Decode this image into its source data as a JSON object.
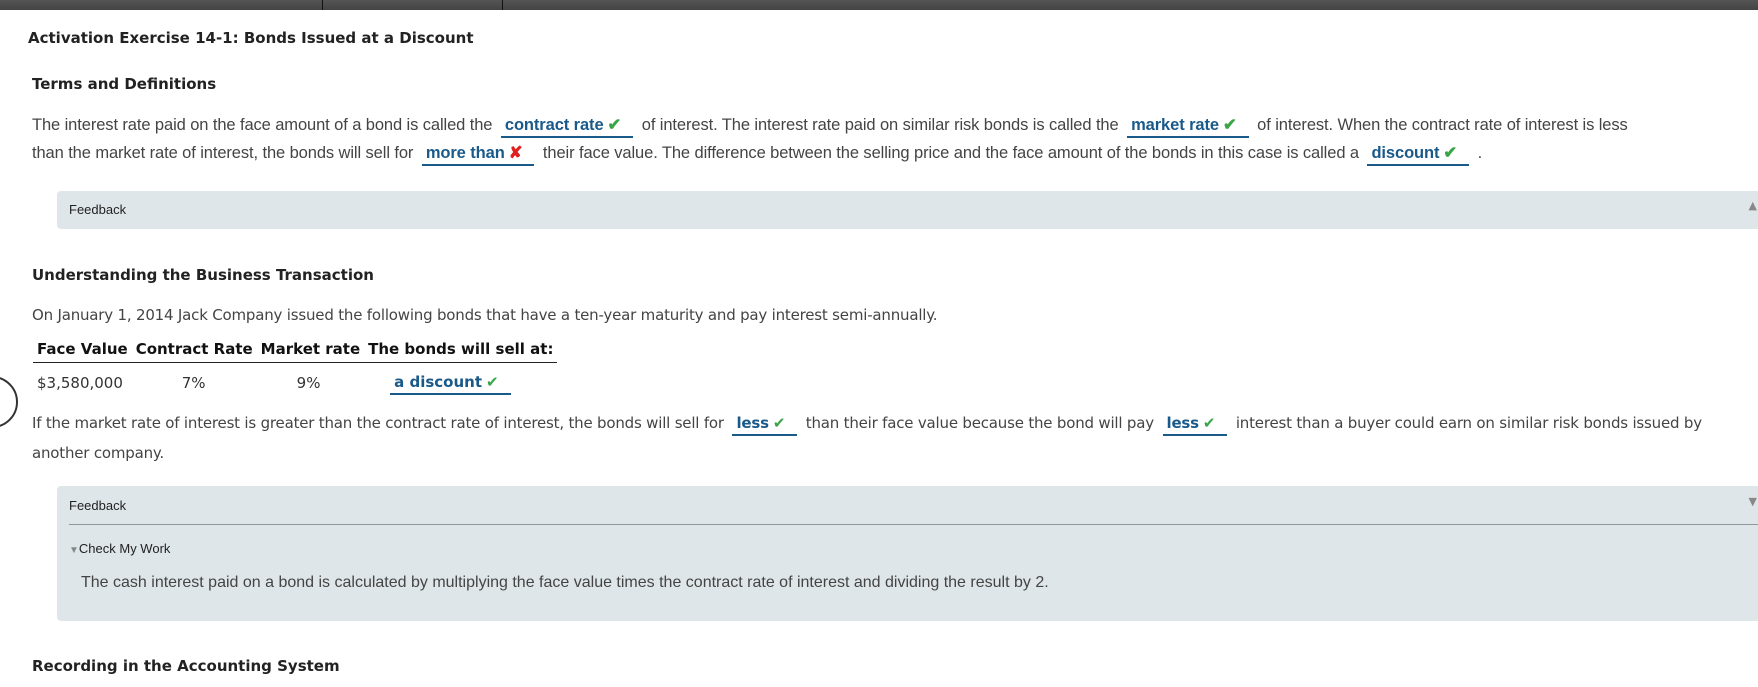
{
  "page": {
    "title": "Activation Exercise 14-1: Bonds Issued at a Discount"
  },
  "terms": {
    "heading": "Terms and Definitions",
    "line1": {
      "t1": "The interest rate paid on the face amount of a bond is called the",
      "a1": "contract rate",
      "a1_status": "correct",
      "t2": "of interest. The interest rate paid on similar risk bonds is called the",
      "a2": "market rate",
      "a2_status": "correct",
      "t3": "of interest. When the contract rate of interest is less"
    },
    "line2": {
      "t1": "than the market rate of interest, the bonds will sell for",
      "a1": "more than",
      "a1_status": "incorrect",
      "t2": "their face value. The difference between the selling price and the face amount of the bonds in this case is called a",
      "a2": "discount",
      "a2_status": "correct",
      "t3": "."
    },
    "feedback_label": "Feedback",
    "feedback_state": "collapsed"
  },
  "transaction": {
    "heading": "Understanding the Business Transaction",
    "intro": "On January 1, 2014 Jack Company issued the following bonds that have a ten-year maturity and pay interest semi-annually.",
    "table": {
      "headers": [
        "Face Value",
        "Contract Rate",
        "Market rate",
        "The bonds will sell at:"
      ],
      "row": {
        "face_value": "$3,580,000",
        "contract_rate": "7%",
        "market_rate": "9%",
        "sell_at": "a discount",
        "sell_at_status": "correct"
      }
    },
    "line1": {
      "t1": "If the market rate of interest is greater than the contract rate of interest, the bonds will sell for",
      "a1": "less",
      "a1_status": "correct",
      "t2": "than their face value because the bond will pay",
      "a2": "less",
      "a2_status": "correct",
      "t3": "interest than a buyer could earn on similar risk bonds issued by"
    },
    "line2": "another company.",
    "feedback_label": "Feedback",
    "feedback_state": "expanded",
    "check_my_work_label": "Check My Work",
    "check_my_work_text": "The cash interest paid on a bond is calculated by multiplying the face value times the contract rate of interest and dividing the result by 2."
  },
  "recording": {
    "heading": "Recording in the Accounting System"
  },
  "icons": {
    "correct": "✔",
    "incorrect": "✘",
    "collapse_up": "▲",
    "expand_down": "▼"
  },
  "colors": {
    "answer": "#1a5a8a",
    "correct": "#3aa548",
    "incorrect": "#e02020",
    "feedback_bg": "#dfe6ea"
  }
}
